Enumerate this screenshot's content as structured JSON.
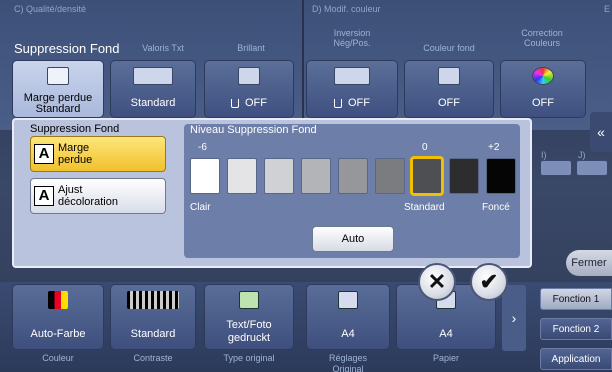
{
  "top_sections": {
    "quality": "C) Qualité/densité",
    "color_mod": "D) Modif. couleur",
    "third": "E"
  },
  "columns": {
    "supp_fond": "Suppression Fond",
    "valoris": "Valoris Txt",
    "brillant": "Brillant",
    "inversion": "Inversion\nNég/Pos.",
    "couleur_fond": "Couleur fond",
    "correction": "Correction\nCouleurs"
  },
  "tiles": {
    "supp_fond": "Marge perdue\nStandard",
    "valoris": "Standard",
    "brillant": "OFF",
    "inversion": "OFF",
    "couleur_fond": "OFF",
    "correction": "OFF"
  },
  "dialog": {
    "left_title": "Suppression Fond",
    "opt1": "Marge\nperdue",
    "opt2": "Ajust\ndécoloration",
    "right_title": "Niveau Suppression Fond",
    "tick_min": "-6",
    "tick_zero": "0",
    "tick_max": "+2",
    "label_light": "Clair",
    "label_std": "Standard",
    "label_dark": "Foncé",
    "auto": "Auto",
    "selected_level": 0,
    "swatch_colors": [
      "#ffffff",
      "#e4e4e6",
      "#d0d1d4",
      "#b3b4b8",
      "#96979b",
      "#7b7c80",
      "#4e4f52",
      "#2d2d2f",
      "#050505"
    ]
  },
  "actions": {
    "cancel": "✕",
    "ok": "✔"
  },
  "right_strip": {
    "expand": "«",
    "label1": "I)",
    "label2": "J)",
    "fermer": "Fermer"
  },
  "bottom_tiles": {
    "couleur": "Auto-Farbe",
    "contraste": "Standard",
    "type_orig": "Text/Foto\ngedruckt",
    "reglages": "A4",
    "papier": "A4"
  },
  "bottom_categories": {
    "couleur": "Couleur",
    "contraste": "Contraste",
    "type_orig": "Type original",
    "reglages": "Réglages\nOriginal",
    "papier": "Papier"
  },
  "functions": {
    "f1": "Fonction 1",
    "f2": "Fonction 2",
    "app": "Application"
  }
}
